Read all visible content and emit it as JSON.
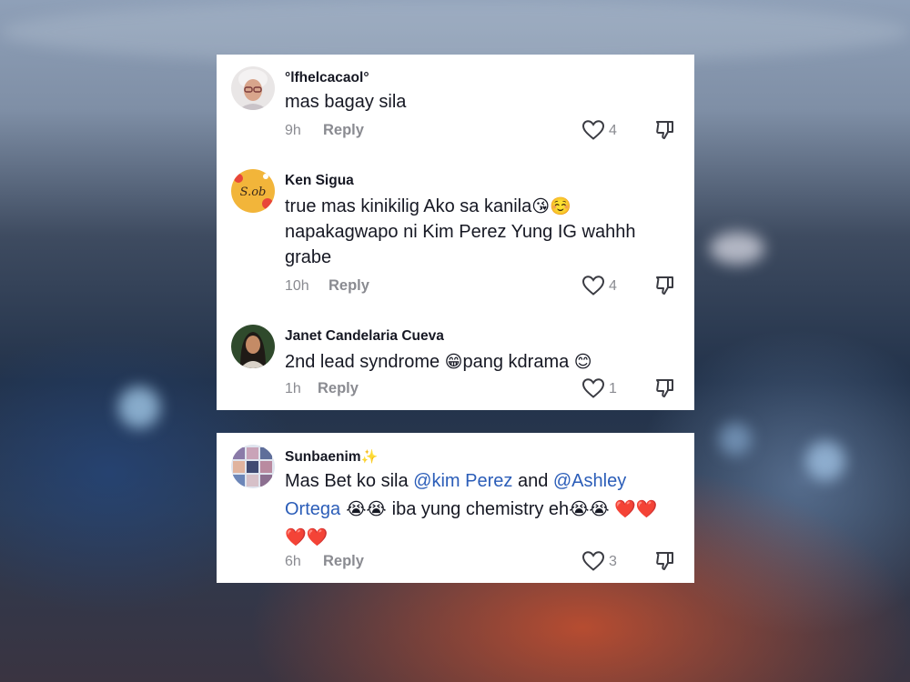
{
  "comments": [
    {
      "username": "°lfhelcacaol°",
      "text": "mas bagay sila",
      "emoji": "",
      "time": "9h",
      "reply_label": "Reply",
      "likes": "4"
    },
    {
      "username": "Ken Sigua",
      "text": "true mas kinikilig Ako sa kanila",
      "emoji": "😘☺️",
      "text2": "napakagwapo ni Kim Perez Yung IG wahhh grabe",
      "time": "10h",
      "reply_label": "Reply",
      "likes": "4"
    },
    {
      "username": "Janet Candelaria Cueva",
      "text": "2nd lead syndrome ",
      "emoji": "😁",
      "text2": "pang kdrama ",
      "emoji2": "😊",
      "time": "1h",
      "reply_label": "Reply",
      "likes": "1"
    },
    {
      "username": "Sunbaenim",
      "username_emoji": "✨",
      "text_prefix": "Mas Bet ko sila ",
      "mention1": "@kim Perez",
      "text_mid": " and ",
      "mention2": "@Ashley Ortega",
      "emoji_a": " 😭😭 ",
      "text_end": "iba yung chemistry eh",
      "emoji_b": "😭😭",
      "hearts": "❤️❤️❤️❤️",
      "time": "6h",
      "reply_label": "Reply",
      "likes": "3"
    }
  ],
  "colors": {
    "text": "#161823",
    "muted": "#8a8b91",
    "mention": "#2b5db8"
  },
  "icons": {
    "like": "heart-outline-icon",
    "dislike": "thumbs-down-icon"
  }
}
